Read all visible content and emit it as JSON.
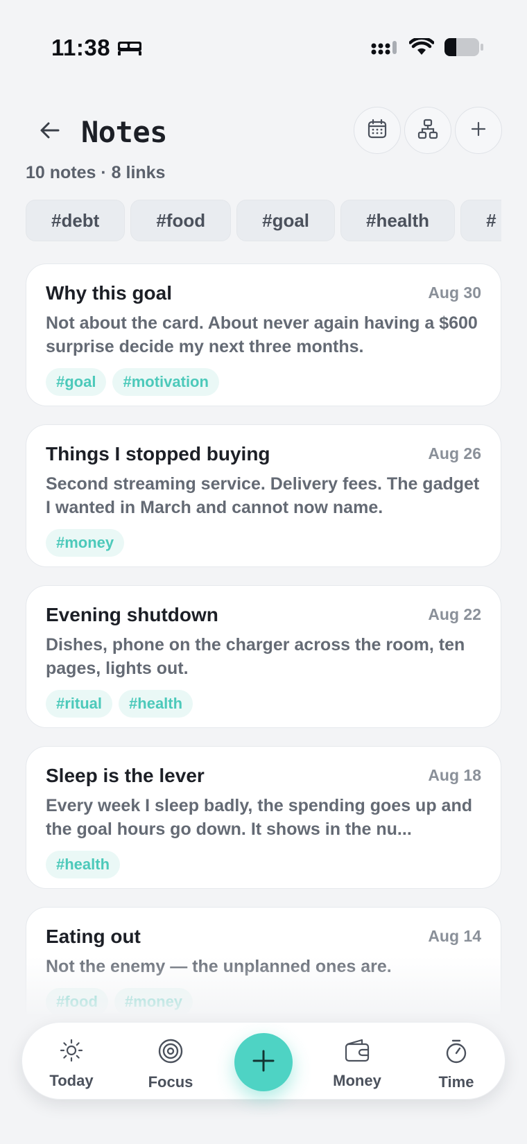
{
  "status": {
    "time": "11:38",
    "focus_icon": "bed-icon",
    "icons": [
      "cellular-signal-icon",
      "wifi-icon",
      "battery-icon"
    ]
  },
  "header": {
    "title": "Notes",
    "back_icon": "arrow-left-icon",
    "actions": [
      "calendar-icon",
      "graph-icon",
      "plus-icon"
    ]
  },
  "summary": "10 notes · 8 links",
  "tag_filters": [
    "#debt",
    "#food",
    "#goal",
    "#health",
    "#"
  ],
  "notes": [
    {
      "title": "Why this goal",
      "date": "Aug 30",
      "body": "Not about the card. About never again having a $600 surprise decide my next three months.",
      "tags": [
        "#goal",
        "#motivation"
      ]
    },
    {
      "title": "Things I stopped buying",
      "date": "Aug 26",
      "body": "Second streaming service. Delivery fees. The gadget I wanted in March and cannot now name.",
      "tags": [
        "#money"
      ]
    },
    {
      "title": "Evening shutdown",
      "date": "Aug 22",
      "body": "Dishes, phone on the charger across the room, ten pages, lights out.",
      "tags": [
        "#ritual",
        "#health"
      ]
    },
    {
      "title": "Sleep is the lever",
      "date": "Aug 18",
      "body": "Every week I sleep badly, the spending goes up and the goal hours go down. It shows in the nu...",
      "tags": [
        "#health"
      ]
    },
    {
      "title": "Eating out",
      "date": "Aug 14",
      "body": "Not the enemy — the unplanned ones are.",
      "tags": [
        "#food",
        "#money"
      ]
    }
  ],
  "tabbar": {
    "tabs": [
      {
        "label": "Today",
        "icon": "sun-icon"
      },
      {
        "label": "Focus",
        "icon": "target-icon"
      },
      {
        "label": "Money",
        "icon": "wallet-icon"
      },
      {
        "label": "Time",
        "icon": "stopwatch-icon"
      }
    ],
    "fab_icon": "plus-icon"
  },
  "colors": {
    "accent": "#4ed3c4",
    "tag_text": "#4cc9ba",
    "tag_bg": "#eaf8f6",
    "background": "#f3f4f6"
  }
}
